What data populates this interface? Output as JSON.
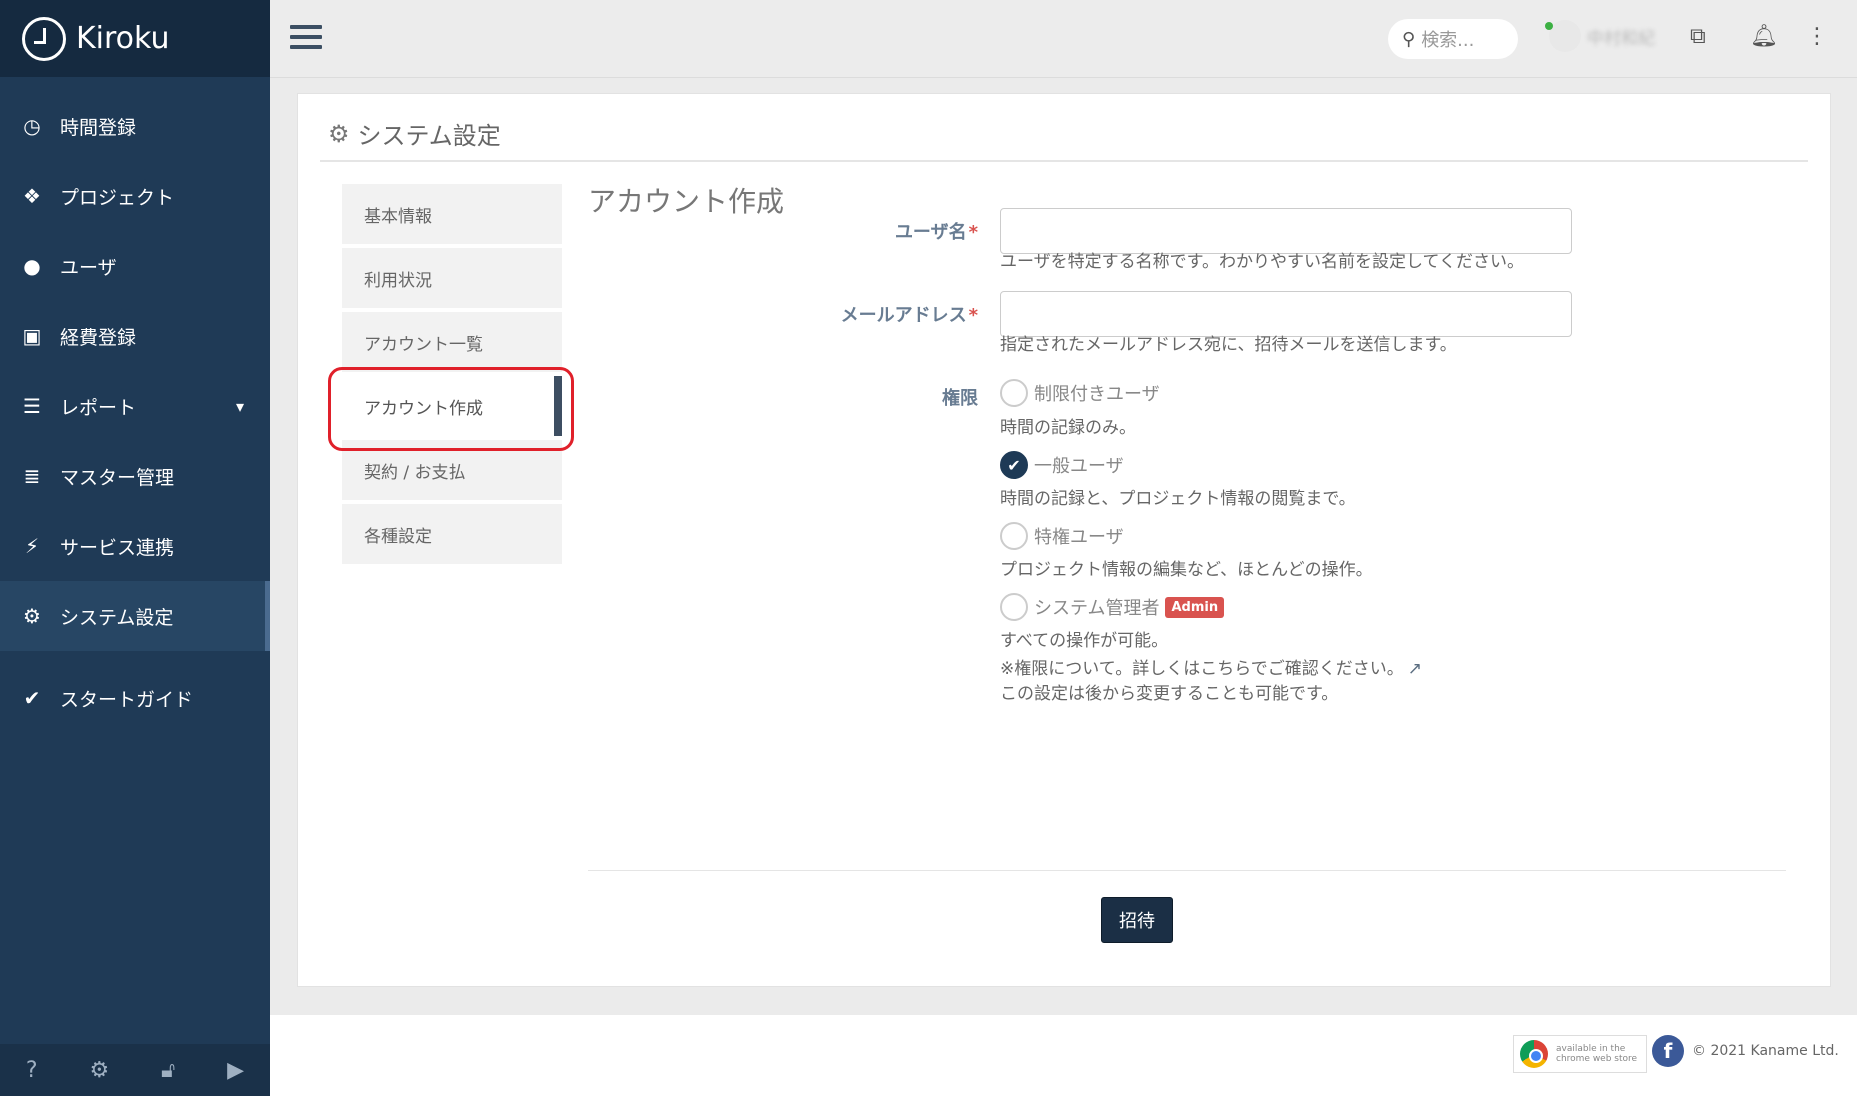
{
  "brand": {
    "name": "Kiroku"
  },
  "sidebar": {
    "items": [
      {
        "label": "時間登録",
        "icon": "clock-icon"
      },
      {
        "label": "プロジェクト",
        "icon": "cubes-icon"
      },
      {
        "label": "ユーザ",
        "icon": "user-icon"
      },
      {
        "label": "経費登録",
        "icon": "train-icon"
      },
      {
        "label": "レポート",
        "icon": "list-icon"
      },
      {
        "label": "マスター管理",
        "icon": "database-icon"
      },
      {
        "label": "サービス連携",
        "icon": "plug-icon"
      },
      {
        "label": "システム設定",
        "icon": "gear-icon"
      },
      {
        "label": "スタートガイド",
        "icon": "check-icon"
      }
    ]
  },
  "header": {
    "search_placeholder": "検索...",
    "user_name": "中村和紀"
  },
  "page": {
    "title": "システム設定"
  },
  "subnav": {
    "items": [
      {
        "label": "基本情報"
      },
      {
        "label": "利用状況"
      },
      {
        "label": "アカウント一覧"
      },
      {
        "label": "アカウント作成"
      },
      {
        "label": "契約 / お支払"
      },
      {
        "label": "各種設定"
      }
    ]
  },
  "form": {
    "title": "アカウント作成",
    "username_label": "ユーザ名",
    "username_help": "ユーザを特定する名称です。わかりやすい名前を設定してください。",
    "email_label": "メールアドレス",
    "email_help": "指定されたメールアドレス宛に、招待メールを送信します。",
    "required_mark": "*",
    "role_label": "権限",
    "roles": [
      {
        "label": "制限付きユーザ",
        "desc": "時間の記録のみ。",
        "checked": false
      },
      {
        "label": "一般ユーザ",
        "desc": "時間の記録と、プロジェクト情報の閲覧まで。",
        "checked": true
      },
      {
        "label": "特権ユーザ",
        "desc": "プロジェクト情報の編集など、ほとんどの操作。",
        "checked": false
      },
      {
        "label": "システム管理者",
        "desc": "すべての操作が可能。",
        "checked": false,
        "badge": "Admin"
      }
    ],
    "note_line1": "※権限について。詳しくはこちらでご確認ください。",
    "note_line2": "この設定は後から変更することも可能です。",
    "submit_label": "招待"
  },
  "footer": {
    "cws_line1": "available in the",
    "cws_line2": "chrome web store",
    "copyright": "© 2021 Kaname Ltd."
  },
  "colors": {
    "sidebar_bg": "#1f3a56",
    "primary_button": "#1b2f45",
    "highlight": "#e0202a",
    "admin_badge": "#d9534f"
  }
}
